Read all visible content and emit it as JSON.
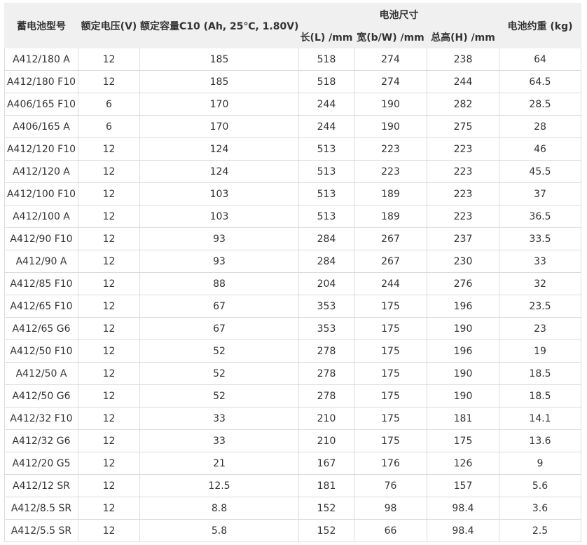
{
  "table": {
    "headers": {
      "model": "蓄电池型号",
      "voltage": "额定电压(V)",
      "capacity": "额定容量C10 (Ah, 25℃, 1.80V)",
      "dimensions": "电池尺寸",
      "length": "长(L) /mm",
      "width": "宽(b/W) /mm",
      "height": "总高(H) /mm",
      "weight": "电池约重 (kg)"
    },
    "rows": [
      [
        "A412/180 A",
        "12",
        "185",
        "518",
        "274",
        "238",
        "64"
      ],
      [
        "A412/180 F10",
        "12",
        "185",
        "518",
        "274",
        "244",
        "64.5"
      ],
      [
        "A406/165 F10",
        "6",
        "170",
        "244",
        "190",
        "282",
        "28.5"
      ],
      [
        "A406/165 A",
        "6",
        "170",
        "244",
        "190",
        "275",
        "28"
      ],
      [
        "A412/120 F10",
        "12",
        "124",
        "513",
        "223",
        "223",
        "46"
      ],
      [
        "A412/120 A",
        "12",
        "124",
        "513",
        "223",
        "223",
        "45.5"
      ],
      [
        "A412/100 F10",
        "12",
        "103",
        "513",
        "189",
        "223",
        "37"
      ],
      [
        "A412/100 A",
        "12",
        "103",
        "513",
        "189",
        "223",
        "36.5"
      ],
      [
        "A412/90 F10",
        "12",
        "93",
        "284",
        "267",
        "237",
        "33.5"
      ],
      [
        "A412/90 A",
        "12",
        "93",
        "284",
        "267",
        "230",
        "33"
      ],
      [
        "A412/85 F10",
        "12",
        "88",
        "204",
        "244",
        "276",
        "32"
      ],
      [
        "A412/65 F10",
        "12",
        "67",
        "353",
        "175",
        "196",
        "23.5"
      ],
      [
        "A412/65 G6",
        "12",
        "67",
        "353",
        "175",
        "190",
        "23"
      ],
      [
        "A412/50 F10",
        "12",
        "52",
        "278",
        "175",
        "196",
        "19"
      ],
      [
        "A412/50 A",
        "12",
        "52",
        "278",
        "175",
        "190",
        "18.5"
      ],
      [
        "A412/50 G6",
        "12",
        "52",
        "278",
        "175",
        "190",
        "18.5"
      ],
      [
        "A412/32 F10",
        "12",
        "33",
        "210",
        "175",
        "181",
        "14.1"
      ],
      [
        "A412/32 G6",
        "12",
        "33",
        "210",
        "175",
        "175",
        "13.6"
      ],
      [
        "A412/20 G5",
        "12",
        "21",
        "167",
        "176",
        "126",
        "9"
      ],
      [
        "A412/12 SR",
        "12",
        "12.5",
        "181",
        "76",
        "157",
        "5.6"
      ],
      [
        "A412/8.5 SR",
        "12",
        "8.8",
        "152",
        "98",
        "98.4",
        "3.6"
      ],
      [
        "A412/5.5 SR",
        "12",
        "5.8",
        "152",
        "66",
        "98.4",
        "2.5"
      ]
    ]
  }
}
